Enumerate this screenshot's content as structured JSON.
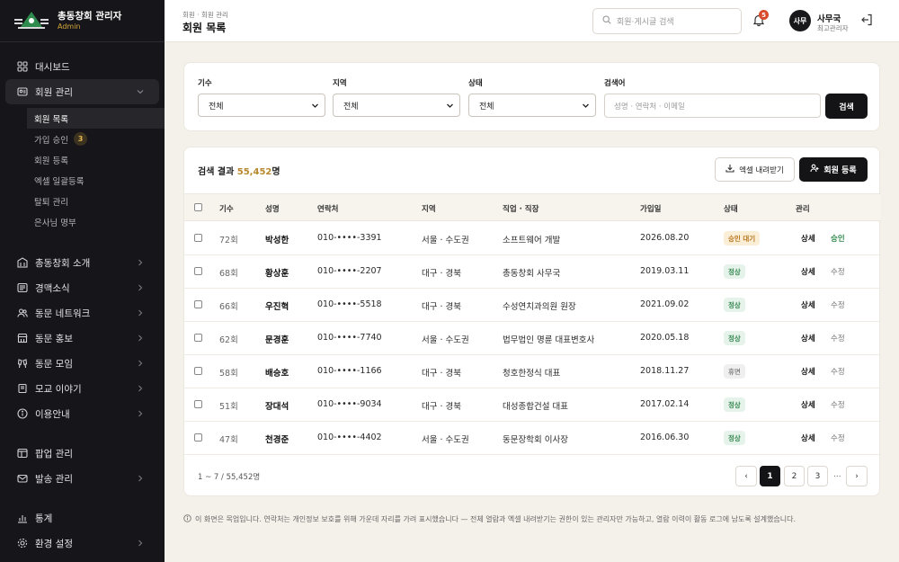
{
  "brand": {
    "title": "총동창회 관리자",
    "subtitle": "Admin",
    "logo_text": "۞"
  },
  "sidebar": {
    "items": [
      {
        "label": "대시보드",
        "icon": "grid-icon"
      },
      {
        "label": "회원 관리",
        "icon": "id-card-icon"
      }
    ],
    "subitems": [
      {
        "label": "회원 목록"
      },
      {
        "label": "가입 승인",
        "badge": "3"
      },
      {
        "label": "회원 등록"
      },
      {
        "label": "엑셀 일괄등록"
      },
      {
        "label": "탈퇴 관리"
      },
      {
        "label": "은사님 명부"
      }
    ],
    "groups": [
      {
        "label": "총동창회 소개",
        "icon": "building-icon"
      },
      {
        "label": "경맥소식",
        "icon": "news-icon"
      },
      {
        "label": "동문 네트워크",
        "icon": "people-icon"
      },
      {
        "label": "동문 홍보",
        "icon": "store-icon"
      },
      {
        "label": "동문 모임",
        "icon": "cheers-icon"
      },
      {
        "label": "모교 이야기",
        "icon": "book-icon"
      },
      {
        "label": "이용안내",
        "icon": "info-icon"
      }
    ],
    "groups2": [
      {
        "label": "팝업 관리",
        "icon": "window-icon"
      },
      {
        "label": "발송 관리",
        "icon": "mail-icon"
      }
    ],
    "groups3": [
      {
        "label": "통계",
        "icon": "chart-icon"
      },
      {
        "label": "환경 설정",
        "icon": "gear-icon"
      }
    ]
  },
  "header": {
    "breadcrumb": "회원 · 회원 관리",
    "title": "회원 목록",
    "search_placeholder": "회원·게시글 검색",
    "notification_count": "5",
    "avatar_text": "사무",
    "user_name": "사무국",
    "user_role": "최고관리자"
  },
  "filter": {
    "labels": {
      "generation": "기수",
      "region": "지역",
      "status": "상태",
      "keyword": "검색어"
    },
    "values": {
      "generation": "전체",
      "region": "전체",
      "status": "전체"
    },
    "keyword_placeholder": "성명 · 연락처 · 이메일",
    "search_button": "검색"
  },
  "results": {
    "title_prefix": "검색 결과 ",
    "count": "55,452",
    "title_suffix": "명",
    "excel_button": "엑셀 내려받기",
    "add_button": "회원 등록",
    "columns": [
      "기수",
      "성명",
      "연락처",
      "지역",
      "직업 · 직장",
      "가입일",
      "상태",
      "관리"
    ],
    "rows": [
      {
        "gen": "72회",
        "name": "박성한",
        "phone": "010-••••-3391",
        "region": "서울 · 수도권",
        "job": "소프트웨어 개발",
        "joined": "2026.08.20",
        "status": "승인 대기",
        "status_type": "wait",
        "act1": "상세",
        "act2": "승인"
      },
      {
        "gen": "68회",
        "name": "황상훈",
        "phone": "010-••••-2207",
        "region": "대구 · 경북",
        "job": "총동창회 사무국",
        "joined": "2019.03.11",
        "status": "정상",
        "status_type": "ok",
        "act1": "상세",
        "act2": "수정"
      },
      {
        "gen": "66회",
        "name": "우진혁",
        "phone": "010-••••-5518",
        "region": "대구 · 경북",
        "job": "수성연치과의원 원장",
        "joined": "2021.09.02",
        "status": "정상",
        "status_type": "ok",
        "act1": "상세",
        "act2": "수정"
      },
      {
        "gen": "62회",
        "name": "문경훈",
        "phone": "010-••••-7740",
        "region": "서울 · 수도권",
        "job": "법무법인 명륜 대표변호사",
        "joined": "2020.05.18",
        "status": "정상",
        "status_type": "ok",
        "act1": "상세",
        "act2": "수정"
      },
      {
        "gen": "58회",
        "name": "배승호",
        "phone": "010-••••-1166",
        "region": "대구 · 경북",
        "job": "청호한정식 대표",
        "joined": "2018.11.27",
        "status": "휴면",
        "status_type": "rest",
        "act1": "상세",
        "act2": "수정"
      },
      {
        "gen": "51회",
        "name": "장대석",
        "phone": "010-••••-9034",
        "region": "대구 · 경북",
        "job": "대성종합건설 대표",
        "joined": "2017.02.14",
        "status": "정상",
        "status_type": "ok",
        "act1": "상세",
        "act2": "수정"
      },
      {
        "gen": "47회",
        "name": "천경준",
        "phone": "010-••••-4402",
        "region": "서울 · 수도권",
        "job": "동문장학회 이사장",
        "joined": "2016.06.30",
        "status": "정상",
        "status_type": "ok",
        "act1": "상세",
        "act2": "수정"
      }
    ],
    "range": "1 ~ 7 / 55,452명",
    "pages": [
      "1",
      "2",
      "3"
    ],
    "ellipsis": "...",
    "prev": "‹",
    "next": "›"
  },
  "notice": "이 화면은 목업입니다. 연락처는 개인정보 보호를 위해 가운데 자리를 가려 표시했습니다 — 전체 열람과 엑셀 내려받기는 권한이 있는 관리자만 가능하고, 열람 이력이 활동 로그에 남도록 설계했습니다.",
  "colors": {
    "accent": "#b8892c",
    "sidebar_bg": "#16161a",
    "page_bg": "#f4f1ea"
  }
}
